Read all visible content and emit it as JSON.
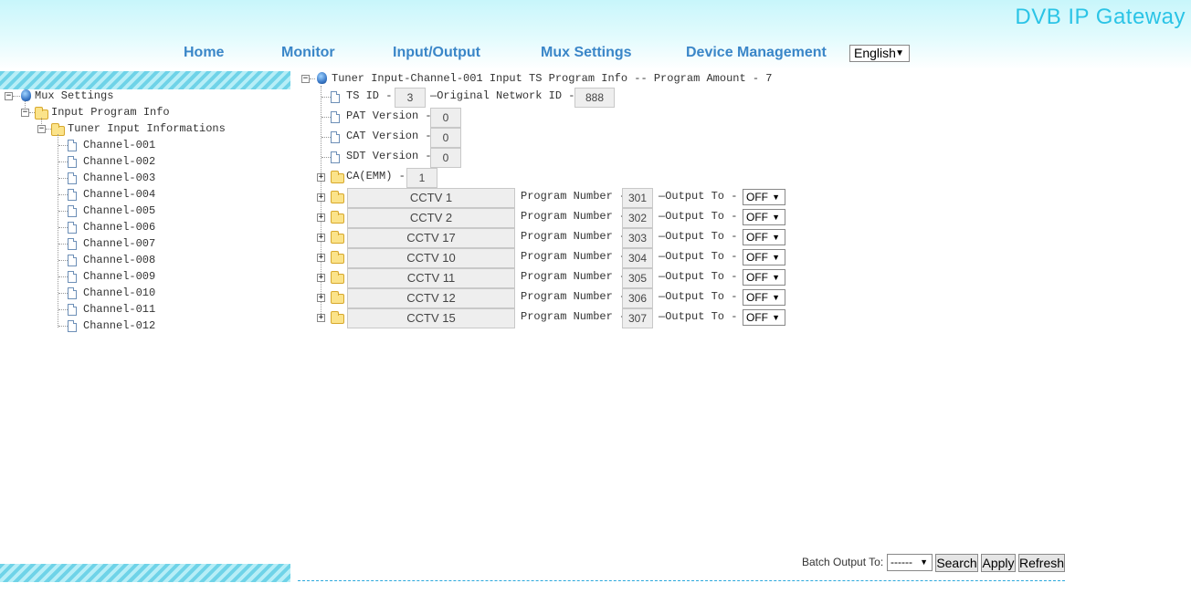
{
  "header": {
    "brand": "DVB IP Gateway"
  },
  "nav": {
    "items": [
      "Home",
      "Monitor",
      "Input/Output",
      "Mux Settings",
      "Device Management"
    ],
    "language": "English"
  },
  "sidebar": {
    "root": "Mux Settings",
    "group": "Input Program Info",
    "subgroup": "Tuner Input Informations",
    "channels": [
      "Channel-001",
      "Channel-002",
      "Channel-003",
      "Channel-004",
      "Channel-005",
      "Channel-006",
      "Channel-007",
      "Channel-008",
      "Channel-009",
      "Channel-010",
      "Channel-011",
      "Channel-012"
    ]
  },
  "main": {
    "title": "Tuner Input-Channel-001 Input TS Program Info -- Program Amount - 7",
    "ts_id_label": "TS ID -",
    "ts_id": "3",
    "onid_label": "—Original Network ID -",
    "onid": "888",
    "pat_label": "PAT Version -",
    "pat": "0",
    "cat_label": "CAT Version -",
    "cat": "0",
    "sdt_label": "SDT Version -",
    "sdt": "0",
    "ca_label": "CA(EMM) -",
    "ca": "1",
    "program_number_label": "Program Number -",
    "output_to_label": "—Output To -",
    "programs": [
      {
        "name": "CCTV 1",
        "number": "301",
        "output": "OFF"
      },
      {
        "name": "CCTV 2",
        "number": "302",
        "output": "OFF"
      },
      {
        "name": "CCTV 17",
        "number": "303",
        "output": "OFF"
      },
      {
        "name": "CCTV 10",
        "number": "304",
        "output": "OFF"
      },
      {
        "name": "CCTV 11",
        "number": "305",
        "output": "OFF"
      },
      {
        "name": "CCTV 12",
        "number": "306",
        "output": "OFF"
      },
      {
        "name": "CCTV 15",
        "number": "307",
        "output": "OFF"
      }
    ]
  },
  "footer": {
    "batch_label": "Batch Output To:",
    "batch_value": "------",
    "search": "Search",
    "apply": "Apply",
    "refresh": "Refresh"
  },
  "icons": {
    "expand": "plus-box-icon",
    "collapse": "minus-box-icon",
    "folder": "folder-icon",
    "doc": "document-icon",
    "root": "globe-icon"
  }
}
